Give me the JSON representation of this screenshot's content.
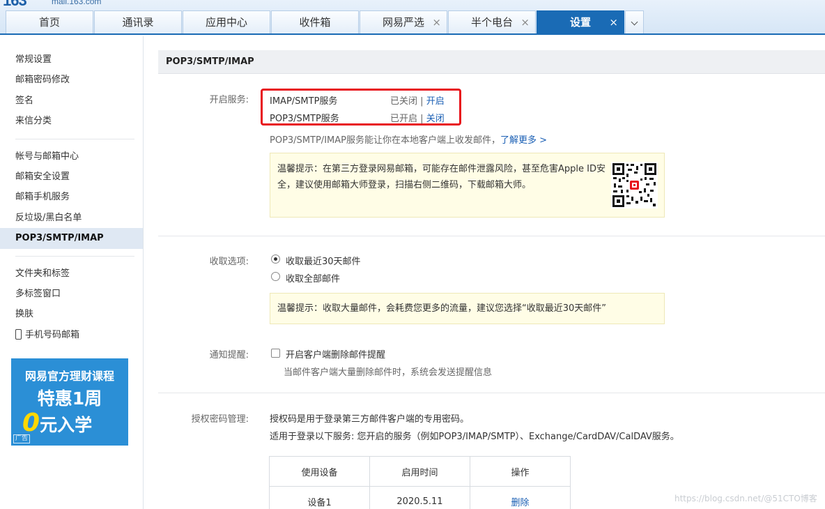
{
  "header": {
    "logo_num": "163",
    "logo_text": "mail.163.com",
    "tabs": [
      {
        "label": "首页",
        "closable": false,
        "active": false
      },
      {
        "label": "通讯录",
        "closable": false,
        "active": false
      },
      {
        "label": "应用中心",
        "closable": false,
        "active": false
      },
      {
        "label": "收件箱",
        "closable": false,
        "active": false
      },
      {
        "label": "网易严选",
        "closable": true,
        "active": false
      },
      {
        "label": "半个电台",
        "closable": true,
        "active": false
      },
      {
        "label": "设置",
        "closable": true,
        "active": true
      }
    ],
    "close_glyph": "×"
  },
  "sidebar": {
    "group1": [
      "常规设置",
      "邮箱密码修改",
      "签名",
      "来信分类"
    ],
    "group2": [
      "帐号与邮箱中心",
      "邮箱安全设置",
      "邮箱手机服务",
      "反垃圾/黑白名单",
      "POP3/SMTP/IMAP"
    ],
    "group3": [
      "文件夹和标签",
      "多标签窗口",
      "换肤",
      "手机号码邮箱"
    ],
    "active_item": "POP3/SMTP/IMAP",
    "ad": {
      "line1": "网易官方理财课程",
      "line2": "特惠1周",
      "line3_zero": "0",
      "line3_rest": "元入学",
      "tag": "广告"
    }
  },
  "main": {
    "section_title": "POP3/SMTP/IMAP",
    "services": {
      "label": "开启服务:",
      "imap": {
        "name": "IMAP/SMTP服务",
        "status": "已关闭",
        "sep": "|",
        "action": "开启"
      },
      "pop3": {
        "name": "POP3/SMTP服务",
        "status": "已开启",
        "sep": "|",
        "action": "关闭"
      },
      "desc": "POP3/SMTP/IMAP服务能让你在本地客户端上收发邮件，",
      "learn_more": "了解更多 >",
      "tip_line1": "温馨提示：在第三方登录网易邮箱，可能存在邮件泄露风险，甚至危害Apple ID安",
      "tip_line2": "全，建议使用邮箱大师登录，扫描右侧二维码，下载邮箱大师。"
    },
    "receive": {
      "label": "收取选项:",
      "option1": "收取最近30天邮件",
      "option2": "收取全部邮件",
      "tip": "温馨提示：收取大量邮件，会耗费您更多的流量，建议您选择“收取最近30天邮件”"
    },
    "notify": {
      "label": "通知提醒:",
      "checkbox_label": "开启客户端删除邮件提醒",
      "desc": "当邮件客户端大量删除邮件时，系统会发送提醒信息"
    },
    "auth": {
      "label": "授权密码管理:",
      "line1": "授权码是用于登录第三方邮件客户端的专用密码。",
      "line2": "适用于登录以下服务: 您开启的服务（例如POP3/IMAP/SMTP）、Exchange/CardDAV/CalDAV服务。",
      "table": {
        "headers": [
          "使用设备",
          "启用时间",
          "操作"
        ],
        "rows": [
          [
            "设备1",
            "2020.5.11",
            "删除"
          ]
        ]
      }
    }
  },
  "watermark": "https://blog.csdn.net/@51CTO博客",
  "colors": {
    "accent": "#1a6bb5",
    "highlight": "#e8131b",
    "link": "#1a5fb4",
    "tip_bg": "#fffde6"
  }
}
